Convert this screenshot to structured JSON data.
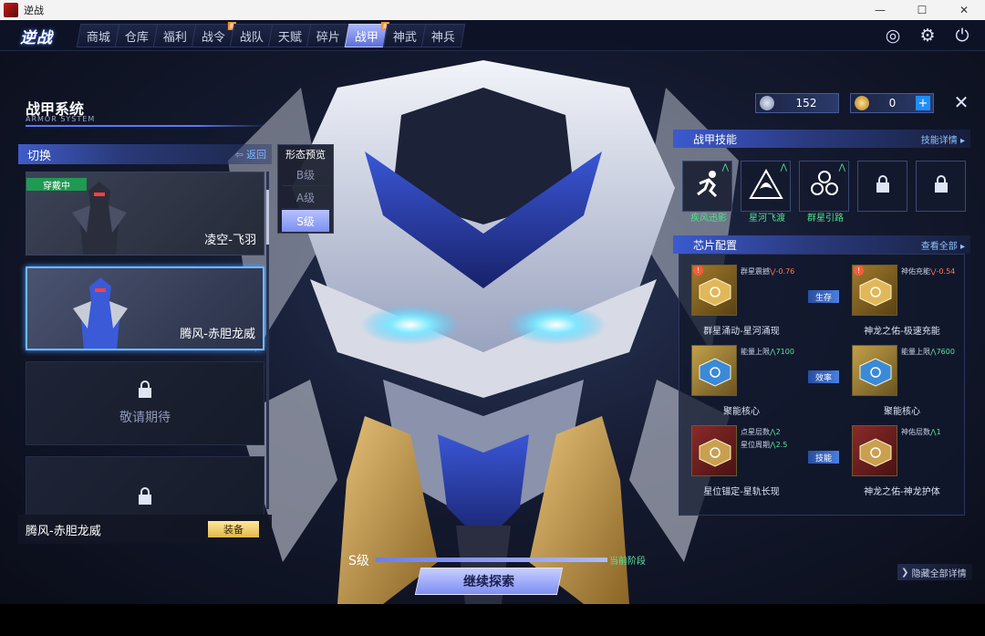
{
  "window": {
    "title": "逆战",
    "minimize": "—",
    "maximize": "☐",
    "close": "✕"
  },
  "game": {
    "logo_text": "逆战"
  },
  "nav": {
    "tabs": [
      {
        "label": "商城",
        "active": false,
        "new": false
      },
      {
        "label": "仓库",
        "active": false,
        "new": false
      },
      {
        "label": "福利",
        "active": false,
        "new": false
      },
      {
        "label": "战令",
        "active": false,
        "new": true
      },
      {
        "label": "战队",
        "active": false,
        "new": false
      },
      {
        "label": "天赋",
        "active": false,
        "new": false
      },
      {
        "label": "碎片",
        "active": false,
        "new": false
      },
      {
        "label": "战甲",
        "active": true,
        "new": true
      },
      {
        "label": "神武",
        "active": false,
        "new": false
      },
      {
        "label": "神兵",
        "active": false,
        "new": false
      }
    ],
    "icons": [
      "target-icon",
      "gear-icon",
      "power-icon"
    ]
  },
  "armor_system": {
    "title": "战甲系统",
    "subtitle": "ARMOR SYSTEM"
  },
  "switch_panel": {
    "label": "切换",
    "back": "返回",
    "cards": [
      {
        "name": "凌空-飞羽",
        "tag": "穿戴中",
        "selected": false,
        "locked": false
      },
      {
        "name": "腾风-赤胆龙威",
        "tag": "",
        "selected": true,
        "locked": false
      },
      {
        "name": "敬请期待",
        "tag": "",
        "selected": false,
        "locked": true
      },
      {
        "name": "",
        "tag": "",
        "selected": false,
        "locked": true
      }
    ],
    "equip": {
      "name": "腾风-赤胆龙威",
      "button": "装备"
    }
  },
  "form_preview": {
    "title": "形态预览",
    "options": [
      {
        "label": "B级",
        "active": false
      },
      {
        "label": "A级",
        "active": false
      },
      {
        "label": "S级",
        "active": true
      }
    ]
  },
  "currency": {
    "silver": {
      "value": "152"
    },
    "gold": {
      "value": "0",
      "plus": "+"
    }
  },
  "close_label": "✕",
  "skills": {
    "title": "战甲技能",
    "link": "技能详情",
    "items": [
      {
        "name": "疾风迅影",
        "icon": "sprint-icon",
        "locked": false
      },
      {
        "name": "星河飞渡",
        "icon": "dragon-emblem-icon",
        "locked": false
      },
      {
        "name": "群星引路",
        "icon": "star-cluster-icon",
        "locked": false
      },
      {
        "name": "",
        "icon": "lock-icon",
        "locked": true
      },
      {
        "name": "",
        "icon": "lock-icon",
        "locked": true
      }
    ]
  },
  "chips": {
    "title": "芯片配置",
    "link": "查看全部",
    "links": [
      "生存",
      "效率",
      "技能"
    ],
    "items": [
      {
        "name": "群星涌动-星河涌现",
        "attr": "群星震撼",
        "val": "-0.76",
        "attr2": "",
        "val2": "",
        "style": "gold",
        "warn": true,
        "val_color": "r"
      },
      {
        "name": "神龙之佑-极速充能",
        "attr": "神佑充能",
        "val": "-0.54",
        "attr2": "",
        "val2": "",
        "style": "gold",
        "warn": true,
        "val_color": "r"
      },
      {
        "name": "聚能核心",
        "attr": "能量上限",
        "val": "7100",
        "attr2": "",
        "val2": "",
        "style": "blue",
        "warn": false,
        "val_color": "g"
      },
      {
        "name": "聚能核心",
        "attr": "能量上限",
        "val": "7600",
        "attr2": "",
        "val2": "",
        "style": "blue",
        "warn": false,
        "val_color": "g"
      },
      {
        "name": "星位锚定-星轨长现",
        "attr": "点星层数",
        "val": "2",
        "attr2": "星位周期",
        "val2": "2.5",
        "style": "red",
        "warn": false,
        "val_color": "g"
      },
      {
        "name": "神龙之佑-神龙护体",
        "attr": "神佑层数",
        "val": "1",
        "attr2": "",
        "val2": "",
        "style": "red",
        "warn": false,
        "val_color": "g"
      }
    ]
  },
  "bottom": {
    "grade": "S级",
    "progress_pct": 100,
    "current_tag": "当前阶段",
    "explore_button": "继续探索",
    "hide_details": "隐藏全部详情"
  },
  "colors": {
    "accent": "#5b6fd8",
    "green": "#5ce29a",
    "link": "#8fc4ff"
  }
}
